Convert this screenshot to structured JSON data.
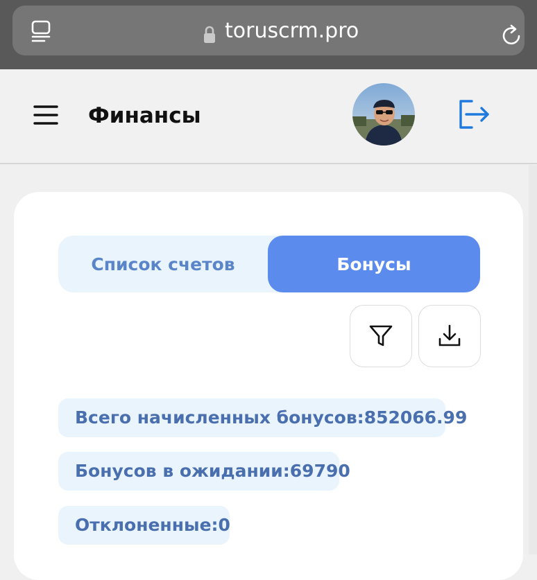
{
  "browser": {
    "url": "toruscrm.pro"
  },
  "header": {
    "title": "Финансы"
  },
  "tabs": [
    {
      "label": "Список счетов",
      "active": false
    },
    {
      "label": "Бонусы",
      "active": true
    }
  ],
  "stats": {
    "total_label": "Всего начисленных бонусов:",
    "total_value": "852066.99",
    "pending_label": "Бонусов в ожидании:",
    "pending_value": "69790",
    "rejected_label": "Отклоненные:",
    "rejected_value": "0"
  },
  "colors": {
    "accent": "#5b8bed",
    "chip_bg": "#eaf4fd",
    "chip_text": "#4a6fae",
    "logout_icon": "#1f7ae0"
  }
}
